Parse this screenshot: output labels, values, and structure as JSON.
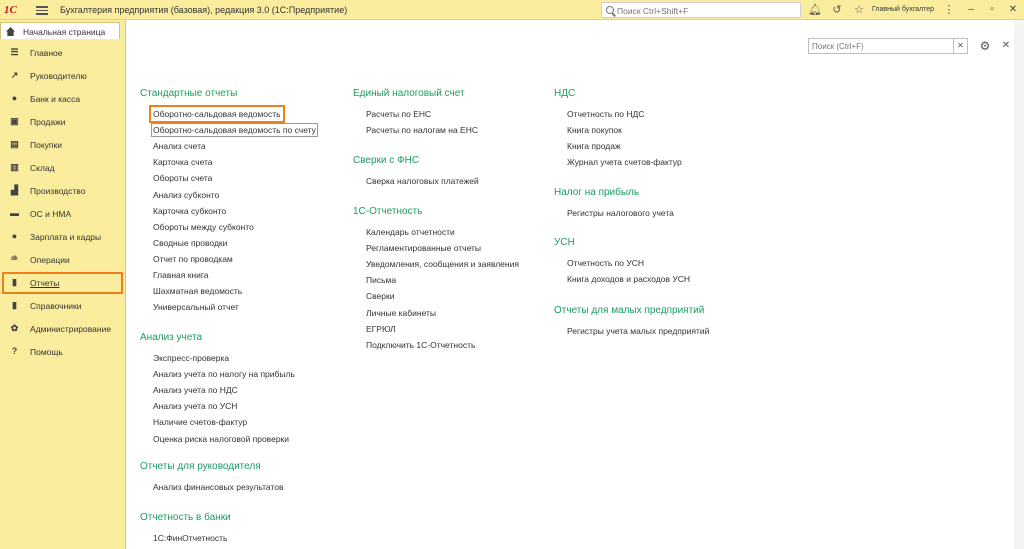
{
  "titlebar": {
    "logo": "1C",
    "title": "Бухгалтерия предприятия (базовая), редакция 3.0  (1С:Предприятие)",
    "search_placeholder": "Поиск Ctrl+Shift+F",
    "user": "Главный бухгалтер"
  },
  "sidebar": {
    "home_tab": "Начальная страница",
    "items": [
      {
        "label": "Главное",
        "icon": "menu-icon"
      },
      {
        "label": "Руководителю",
        "icon": "trend-icon"
      },
      {
        "label": "Банк и касса",
        "icon": "coin-icon"
      },
      {
        "label": "Продажи",
        "icon": "bag-icon"
      },
      {
        "label": "Покупки",
        "icon": "basket-icon"
      },
      {
        "label": "Склад",
        "icon": "warehouse-icon"
      },
      {
        "label": "Производство",
        "icon": "factory-icon"
      },
      {
        "label": "ОС и НМА",
        "icon": "truck-icon"
      },
      {
        "label": "Зарплата и кадры",
        "icon": "person-icon"
      },
      {
        "label": "Операции",
        "icon": "operations-icon"
      },
      {
        "label": "Отчеты",
        "icon": "chart-icon"
      },
      {
        "label": "Справочники",
        "icon": "book-icon"
      },
      {
        "label": "Администрирование",
        "icon": "gear-icon"
      },
      {
        "label": "Помощь",
        "icon": "question-icon"
      }
    ],
    "active_index": 10
  },
  "content": {
    "search_placeholder": "Поиск (Ctrl+F)",
    "column1": [
      {
        "title": "Стандартные отчеты",
        "links": [
          "Оборотно-сальдовая ведомость",
          "Оборотно-сальдовая ведомость по счету",
          "Анализ счета",
          "Карточка счета",
          "Обороты счета",
          "Анализ субконто",
          "Карточка субконто",
          "Обороты между субконто",
          "Сводные проводки",
          "Отчет по проводкам",
          "Главная книга",
          "Шахматная ведомость",
          "Универсальный отчет"
        ]
      },
      {
        "title": "Анализ учета",
        "links": [
          "Экспресс-проверка",
          "Анализ учета по налогу на прибыль",
          "Анализ учета по НДС",
          "Анализ учета по УСН",
          "Наличие счетов-фактур",
          "Оценка риска налоговой проверки"
        ]
      },
      {
        "title": "Отчеты для руководителя",
        "links": [
          "Анализ финансовых результатов"
        ]
      },
      {
        "title": "Отчетность в банки",
        "links": [
          "1С:ФинОтчетность"
        ]
      }
    ],
    "column2": [
      {
        "title": "Единый налоговый счет",
        "links": [
          "Расчеты по ЕНС",
          "Расчеты по налогам на ЕНС"
        ]
      },
      {
        "title": "Сверки с ФНС",
        "links": [
          "Сверка налоговых платежей"
        ]
      },
      {
        "title": "1С-Отчетность",
        "links": [
          "Календарь отчетности",
          "Регламентированные отчеты",
          "Уведомления, сообщения и заявления",
          "Письма",
          "Сверки",
          "Личные кабинеты",
          "ЕГРЮЛ",
          "Подключить 1С-Отчетность"
        ]
      }
    ],
    "column3": [
      {
        "title": "НДС",
        "links": [
          "Отчетность по НДС",
          "Книга покупок",
          "Книга продаж",
          "Журнал учета счетов-фактур"
        ]
      },
      {
        "title": "Налог на прибыль",
        "links": [
          "Регистры налогового учета"
        ]
      },
      {
        "title": "УСН",
        "links": [
          "Отчетность по УСН",
          "Книга доходов и расходов УСН"
        ]
      },
      {
        "title": "Отчеты для малых предприятий",
        "links": [
          "Регистры учета малых предприятий"
        ]
      }
    ]
  },
  "colors": {
    "bar": "#fbed9e",
    "accent": "#ef7f1a",
    "group_title": "#1a9d62"
  }
}
